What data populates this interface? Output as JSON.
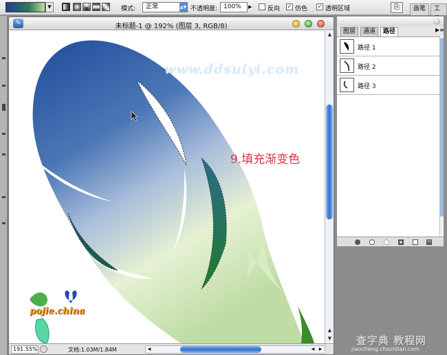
{
  "options_bar": {
    "mode_label": "模式:",
    "mode_value": "正常",
    "opacity_label": "不透明度:",
    "opacity_value": "100%",
    "reverse_label": "反向",
    "reverse_checked": false,
    "dither_label": "仿色",
    "dither_checked": true,
    "transparency_label": "透明区域",
    "transparency_checked": true,
    "dock_tabs": [
      "画笔",
      "工具"
    ]
  },
  "document": {
    "title": "未标题-1 @ 192% (图层 3, RGB/8)",
    "watermark": "www.ddsuiyi.com",
    "step_label": "9.填充渐变色",
    "logo_text": "pojie.china",
    "zoom": "191.55%",
    "doc_info": "文档:1.03M/1.84M"
  },
  "paths_panel": {
    "tabs": [
      "图层",
      "通道",
      "路径"
    ],
    "active_tab": "路径",
    "paths": [
      "路径 1",
      "路径 2",
      "路径 3"
    ]
  },
  "site_mark": {
    "name": "查字典 教程网",
    "url": "jiaocheng.chazidian.com"
  },
  "colors": {
    "gradient_dark": "#2a56a8",
    "gradient_mid": "#2f7a56",
    "gradient_light": "#d7ecc0",
    "step_label": "#d8324a",
    "scroll_accent": "#2e6fcf"
  }
}
